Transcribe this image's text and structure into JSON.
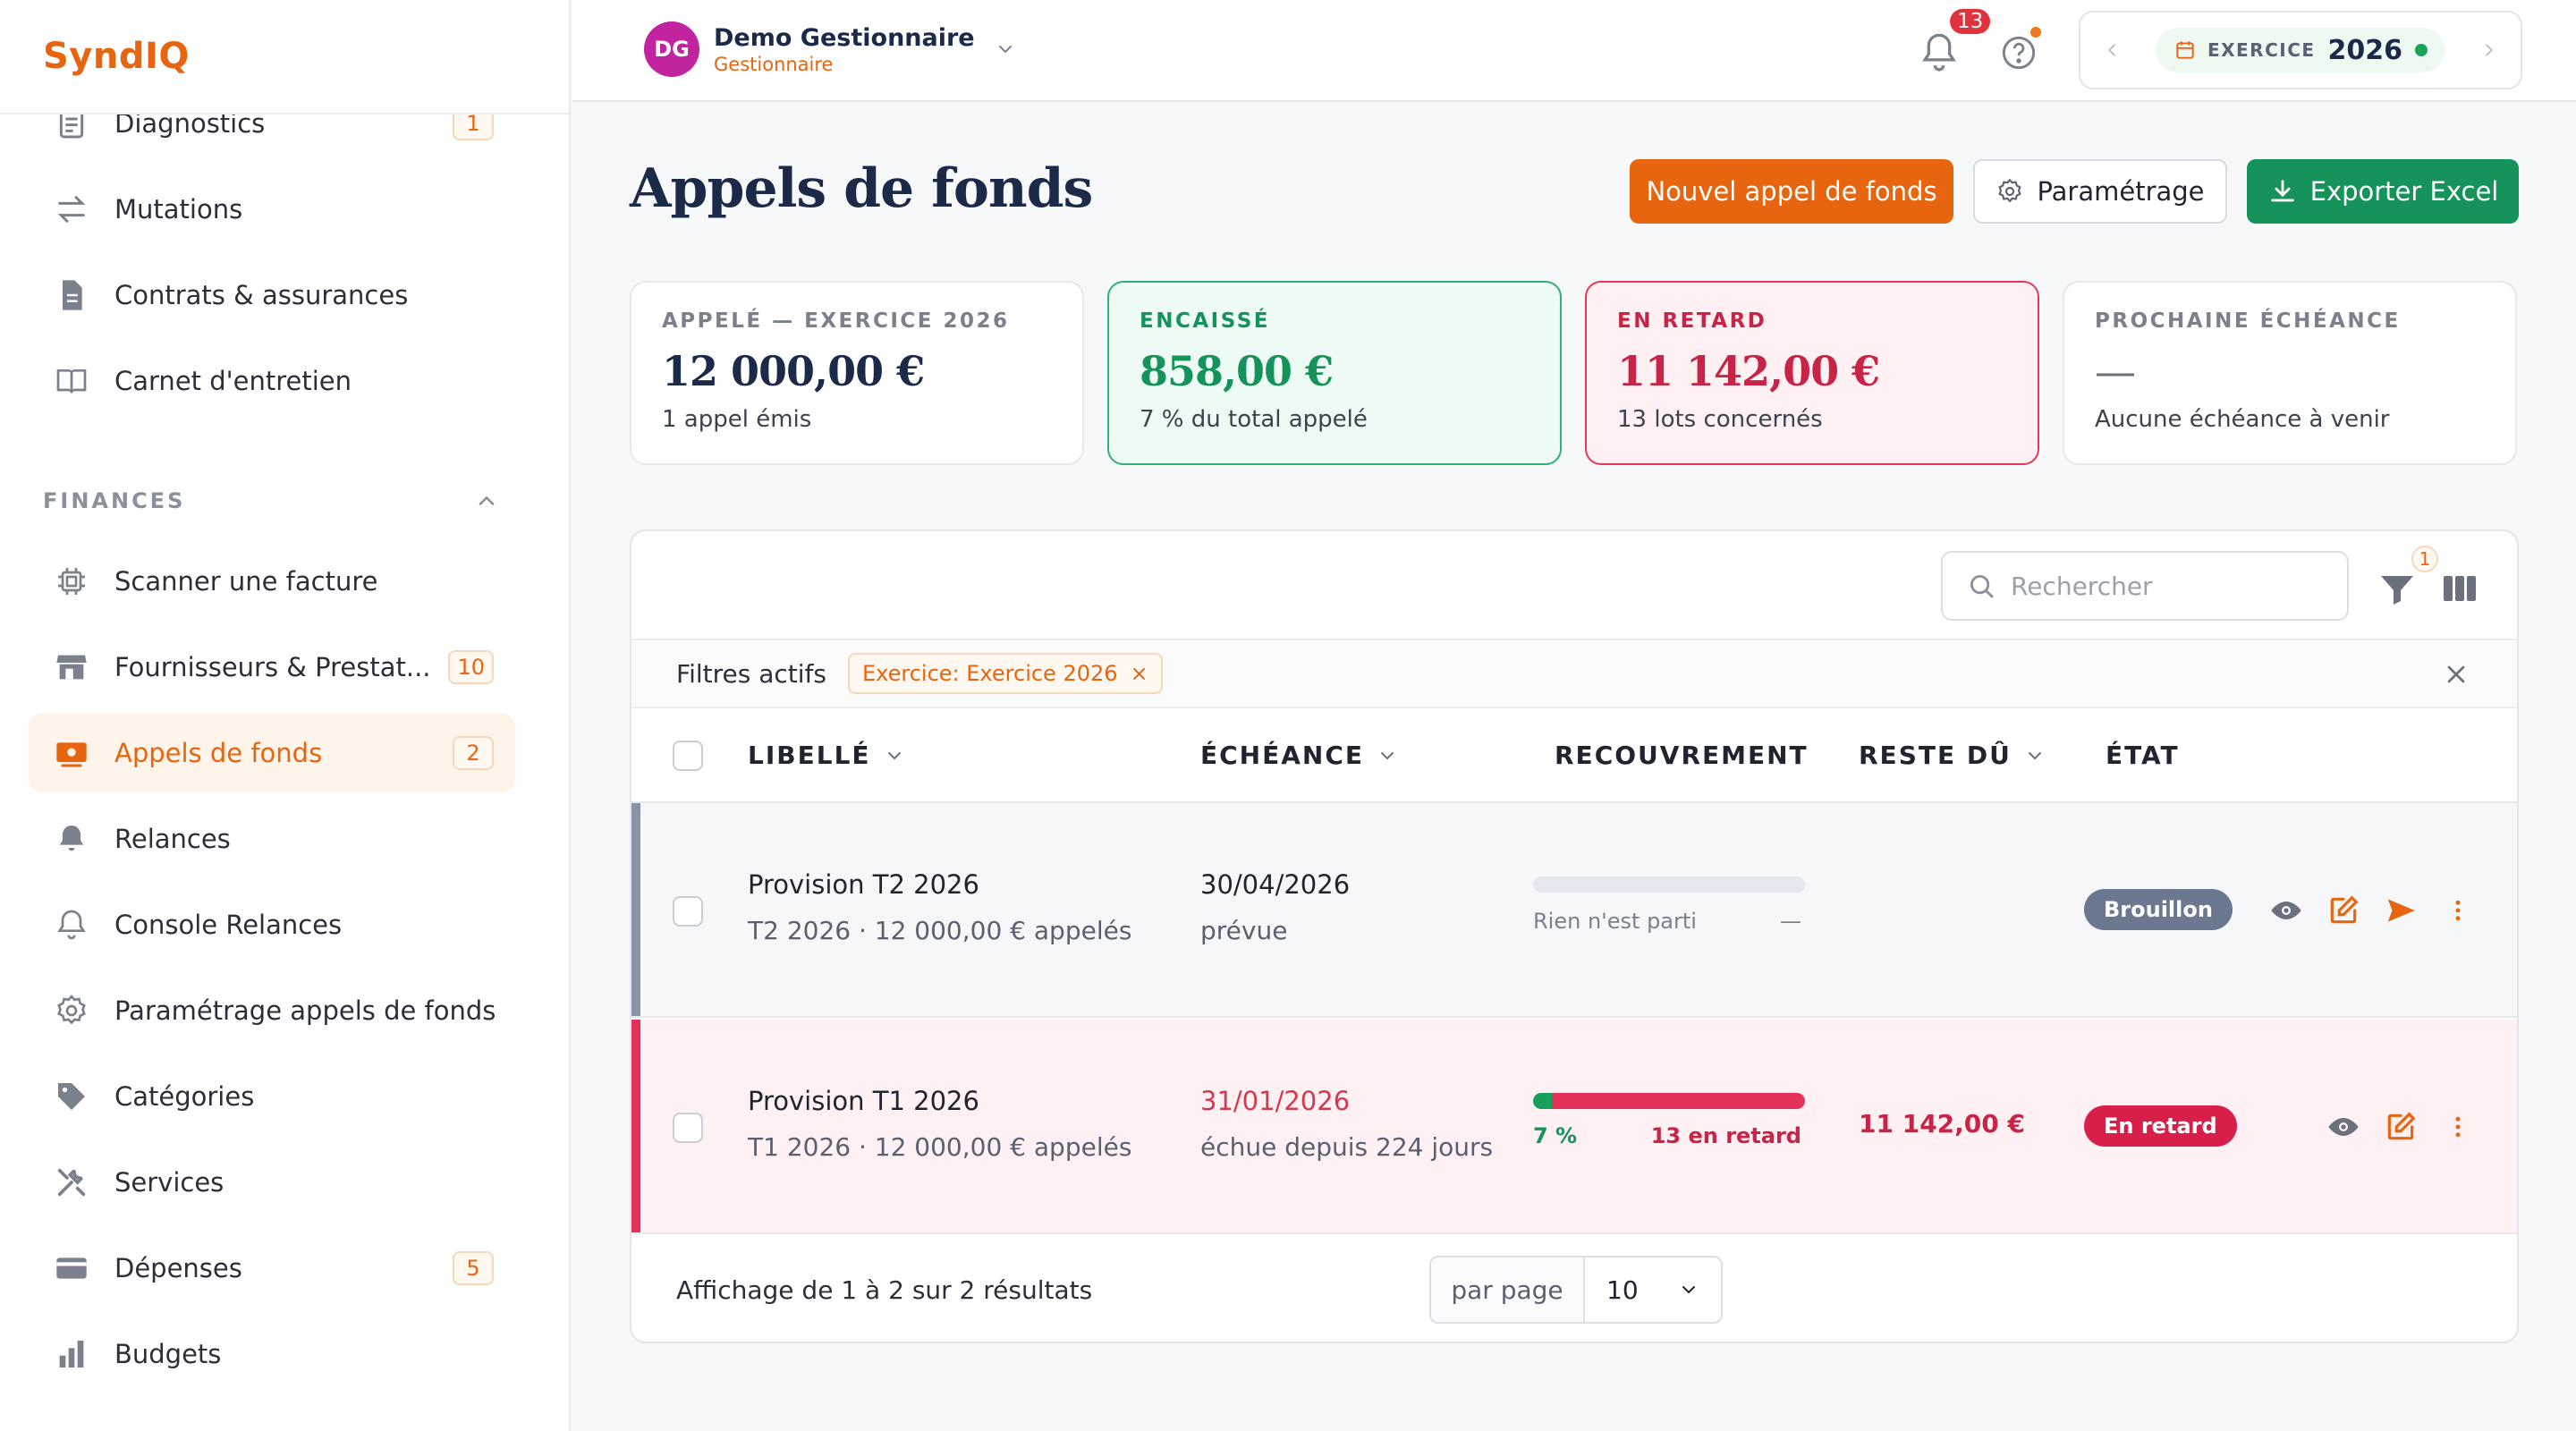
{
  "app": {
    "brand": "SyndIQ"
  },
  "sidebar": {
    "items_top": [
      {
        "label": "Diagnostics",
        "icon": "clipboard-list-icon",
        "badge": "1"
      },
      {
        "label": "Mutations",
        "icon": "arrows-exchange-icon",
        "badge": ""
      },
      {
        "label": "Contrats & assurances",
        "icon": "document-icon",
        "badge": ""
      },
      {
        "label": "Carnet d'entretien",
        "icon": "open-book-icon",
        "badge": ""
      }
    ],
    "section_finances": "FINANCES",
    "items_finances": [
      {
        "label": "Scanner une facture",
        "icon": "scanner-chip-icon",
        "badge": ""
      },
      {
        "label": "Fournisseurs & Prestat...",
        "icon": "store-icon",
        "badge": "10"
      },
      {
        "label": "Appels de fonds",
        "icon": "money-bill-icon",
        "badge": "2",
        "active": true
      },
      {
        "label": "Relances",
        "icon": "bell-filled-icon",
        "badge": ""
      },
      {
        "label": "Console Relances",
        "icon": "bell-outline-icon",
        "badge": ""
      },
      {
        "label": "Paramétrage appels de fonds",
        "icon": "gear-icon",
        "badge": ""
      },
      {
        "label": "Catégories",
        "icon": "tag-icon",
        "badge": ""
      },
      {
        "label": "Services",
        "icon": "tools-icon",
        "badge": ""
      },
      {
        "label": "Dépenses",
        "icon": "credit-card-icon",
        "badge": "5"
      },
      {
        "label": "Budgets",
        "icon": "bar-chart-icon",
        "badge": ""
      }
    ]
  },
  "header": {
    "user": {
      "initials": "DG",
      "name": "Demo Gestionnaire",
      "role": "Gestionnaire"
    },
    "notifications_count": "13",
    "exercise": {
      "label": "EXERCICE",
      "year": "2026"
    }
  },
  "page": {
    "title": "Appels de fonds",
    "buttons": {
      "new": "Nouvel appel de fonds",
      "settings": "Paramétrage",
      "export": "Exporter Excel"
    }
  },
  "kpis": [
    {
      "label": "APPELÉ — EXERCICE 2026",
      "value": "12 000,00 €",
      "sub": "1 appel émis"
    },
    {
      "label": "ENCAISSÉ",
      "value": "858,00 €",
      "sub": "7 % du total appelé"
    },
    {
      "label": "EN RETARD",
      "value": "11 142,00 €",
      "sub": "13 lots concernés"
    },
    {
      "label": "PROCHAINE ÉCHÉANCE",
      "value": "—",
      "sub": "Aucune échéance à venir"
    }
  ],
  "table": {
    "search_placeholder": "Rechercher",
    "filter_count": "1",
    "filters_label": "Filtres actifs",
    "filter_chip": "Exercice: Exercice 2026",
    "columns": [
      "LIBELLÉ",
      "ÉCHÉANCE",
      "RECOUVREMENT",
      "RESTE DÛ",
      "ÉTAT"
    ],
    "rows": [
      {
        "title": "Provision T2 2026",
        "subtitle": "T2 2026 · 12 000,00 € appelés",
        "due_date": "30/04/2026",
        "due_note": "prévue",
        "recovery_percent": 0,
        "late_percent": 0,
        "recovery_left": "Rien n'est parti",
        "recovery_right": "—",
        "remaining": "",
        "status": "Brouillon",
        "status_color": "#6b7890"
      },
      {
        "title": "Provision T1 2026",
        "subtitle": "T1 2026 · 12 000,00 € appelés",
        "due_date": "31/01/2026",
        "due_note": "échue depuis 224 jours",
        "recovery_percent": 7,
        "late_percent": 93,
        "recovery_left": "7 %",
        "recovery_right": "13 en retard",
        "remaining": "11 142,00 €",
        "status": "En retard",
        "status_color": "#d81f4a"
      }
    ],
    "footer_info": "Affichage de 1 à 2 sur 2 résultats",
    "per_page_label": "par page",
    "per_page_value": "10"
  },
  "colors": {
    "accent": "#e8650f",
    "success": "#16935a",
    "danger": "#c72447"
  }
}
